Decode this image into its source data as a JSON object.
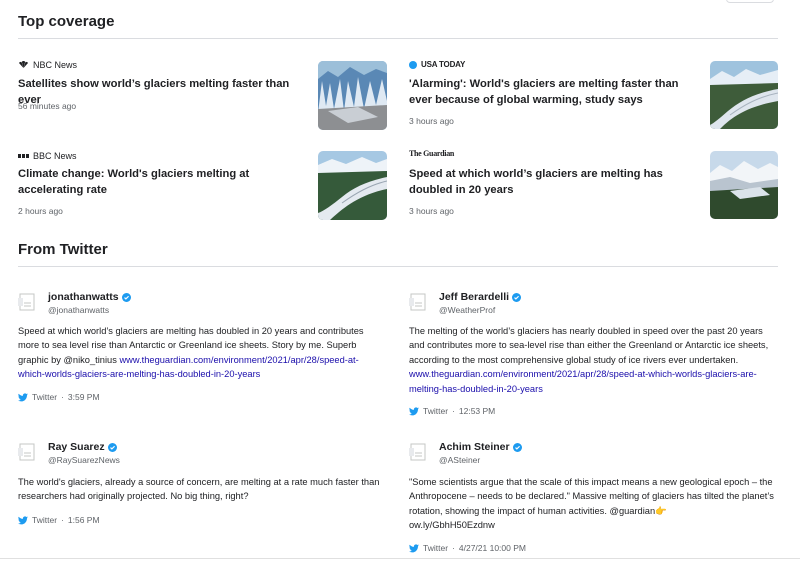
{
  "top_coverage": {
    "title": "Top coverage",
    "articles": [
      {
        "source": "NBC News",
        "logo_icon": "nbc-peacock-icon",
        "headline": "Satellites show world’s glaciers melting faster than ever",
        "time": "56 minutes ago"
      },
      {
        "source": "USA TODAY",
        "logo_icon": "usa-today-logo",
        "headline": "'Alarming': World's glaciers are melting faster than ever because of global warming, study says",
        "time": "3 hours ago"
      },
      {
        "source": "BBC News",
        "logo_icon": "bbc-logo",
        "headline": "Climate change: World's glaciers melting at accelerating rate",
        "time": "2 hours ago"
      },
      {
        "source": "The Guardian",
        "logo_icon": "guardian-logo",
        "headline": "Speed at which world’s glaciers are melting has doubled in 20 years",
        "time": "3 hours ago"
      }
    ]
  },
  "twitter": {
    "title": "From Twitter",
    "tweets": [
      {
        "name": "jonathanwatts",
        "handle": "@jonathanwatts",
        "text": "Speed at which world’s glaciers are melting has doubled in 20 years and contributes more to sea level rise than Antarctic or Greenland ice sheets. Story by me. Superb graphic by @niko_tinius ",
        "link": "www.theguardian.com/environment/2021/apr/28/speed-at-which-worlds-glaciers-are-melting-has-doubled-in-20-years",
        "platform": "Twitter",
        "time": "3:59 PM"
      },
      {
        "name": "Jeff Berardelli",
        "handle": "@WeatherProf",
        "text": "The melting of the world’s glaciers has nearly doubled in speed over the past 20 years and contributes more to sea-level rise than either the Greenland or Antarctic ice sheets, according to the most comprehensive global study of ice rivers ever undertaken.",
        "link": "www.theguardian.com/environment/2021/apr/28/speed-at-which-worlds-glaciers-are-melting-has-doubled-in-20-years",
        "platform": "Twitter",
        "time": "12:53 PM"
      },
      {
        "name": "Ray Suarez",
        "handle": "@RaySuarezNews",
        "text": "The world's glaciers, already a source of concern, are melting at a rate much faster than researchers had originally projected. No big thing, right?",
        "link": "",
        "platform": "Twitter",
        "time": "1:56 PM"
      },
      {
        "name": "Achim Steiner",
        "handle": "@ASteiner",
        "text": "\"Some scientists argue that the scale of this impact means a new geological epoch – the Anthropocene – needs to be declared.\" Massive melting of glaciers has tilted the planet’s rotation, showing the impact of human activities. @guardian👉",
        "link": "ow.ly/GbhH50Ezdnw",
        "platform": "Twitter",
        "time": "4/27/21 10:00 PM"
      }
    ]
  },
  "colors": {
    "link": "#1a0dab",
    "twitter": "#1d9bf0",
    "rule": "#dadce0",
    "muted": "#5f6368"
  }
}
